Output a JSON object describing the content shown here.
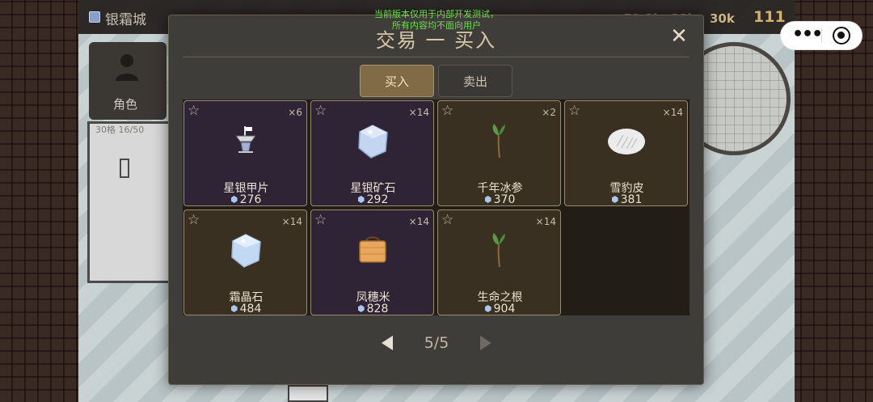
{
  "hud": {
    "city_name": "银霜城",
    "role_label": "角色",
    "role_sub": "30格 16/50",
    "res_partial": "-59.2k -88k",
    "res_food": "30k",
    "res_main": "111"
  },
  "notice": {
    "line1": "当前版本仅用于内部开发测试，",
    "line2": "所有内容均不面向用户"
  },
  "modal": {
    "title": "交易 一 买入",
    "close_icon": "close-icon",
    "tabs": {
      "buy": "买入",
      "sell": "卖出",
      "active": "buy"
    }
  },
  "items": [
    {
      "name": "星银甲片",
      "price": "276",
      "qty": "×6",
      "icon": "silver-armor-plate-icon",
      "theme": "purple"
    },
    {
      "name": "星银矿石",
      "price": "292",
      "qty": "×14",
      "icon": "silver-ore-icon",
      "theme": "purple"
    },
    {
      "name": "千年冰参",
      "price": "370",
      "qty": "×2",
      "icon": "ice-ginseng-sprout-icon",
      "theme": "brown"
    },
    {
      "name": "雪豹皮",
      "price": "381",
      "qty": "×14",
      "icon": "leopard-pelt-icon",
      "theme": "brown"
    },
    {
      "name": "霜晶石",
      "price": "484",
      "qty": "×14",
      "icon": "frost-crystal-icon",
      "theme": "brown"
    },
    {
      "name": "凤穗米",
      "price": "828",
      "qty": "×14",
      "icon": "rice-basket-icon",
      "theme": "purple"
    },
    {
      "name": "生命之根",
      "price": "904",
      "qty": "×14",
      "icon": "life-root-sprout-icon",
      "theme": "brown"
    }
  ],
  "pager": {
    "text": "5/5"
  },
  "colors": {
    "accent": "#816a46",
    "purple_card": "#2f2435",
    "brown_card": "#3a3021",
    "notice": "#6fdc52"
  }
}
